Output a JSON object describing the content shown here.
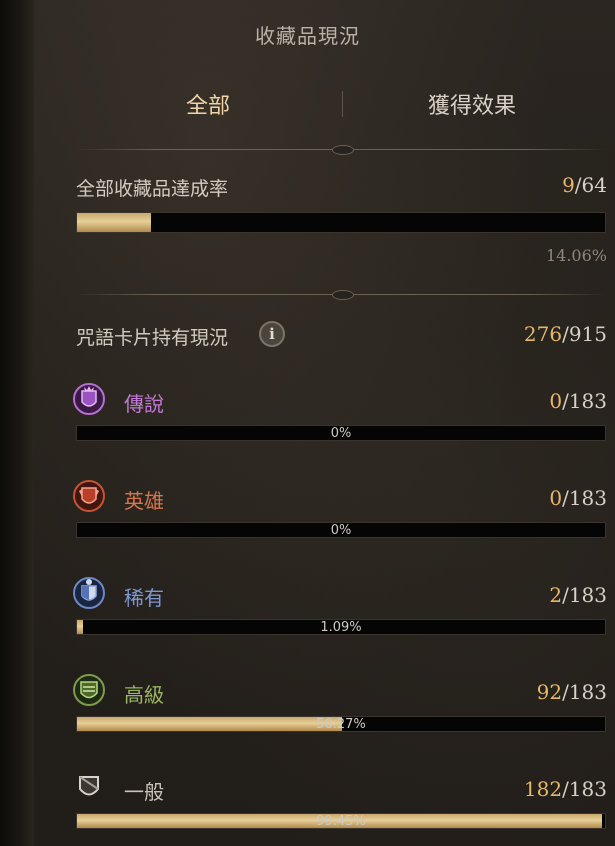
{
  "title": "收藏品現況",
  "tabs": {
    "all": "全部",
    "effects": "獲得效果"
  },
  "overall": {
    "label": "全部收藏品達成率",
    "current": "9",
    "separator": "/",
    "total": "64",
    "percent_text": "14.06%",
    "progress": 0.1406
  },
  "cards": {
    "label": "咒語卡片持有現況",
    "info_icon": "i",
    "current": "276",
    "separator": "/",
    "total": "915"
  },
  "grades": [
    {
      "name": "傳說",
      "color": "#c27ad6",
      "icon": "legendary-crest-icon",
      "current": "0",
      "total": "183",
      "percent_text": "0%",
      "progress": 0.0
    },
    {
      "name": "英雄",
      "color": "#d6764e",
      "icon": "hero-crest-icon",
      "current": "0",
      "total": "183",
      "percent_text": "0%",
      "progress": 0.0
    },
    {
      "name": "稀有",
      "color": "#7d98d4",
      "icon": "rare-crest-icon",
      "current": "2",
      "total": "183",
      "percent_text": "1.09%",
      "progress": 0.0109
    },
    {
      "name": "高級",
      "color": "#9ab563",
      "icon": "advanced-crest-icon",
      "current": "92",
      "total": "183",
      "percent_text": "50.27%",
      "progress": 0.5027
    },
    {
      "name": "一般",
      "color": "#c9c4bb",
      "icon": "common-crest-icon",
      "current": "182",
      "total": "183",
      "percent_text": "99.45%",
      "progress": 0.9945
    }
  ]
}
